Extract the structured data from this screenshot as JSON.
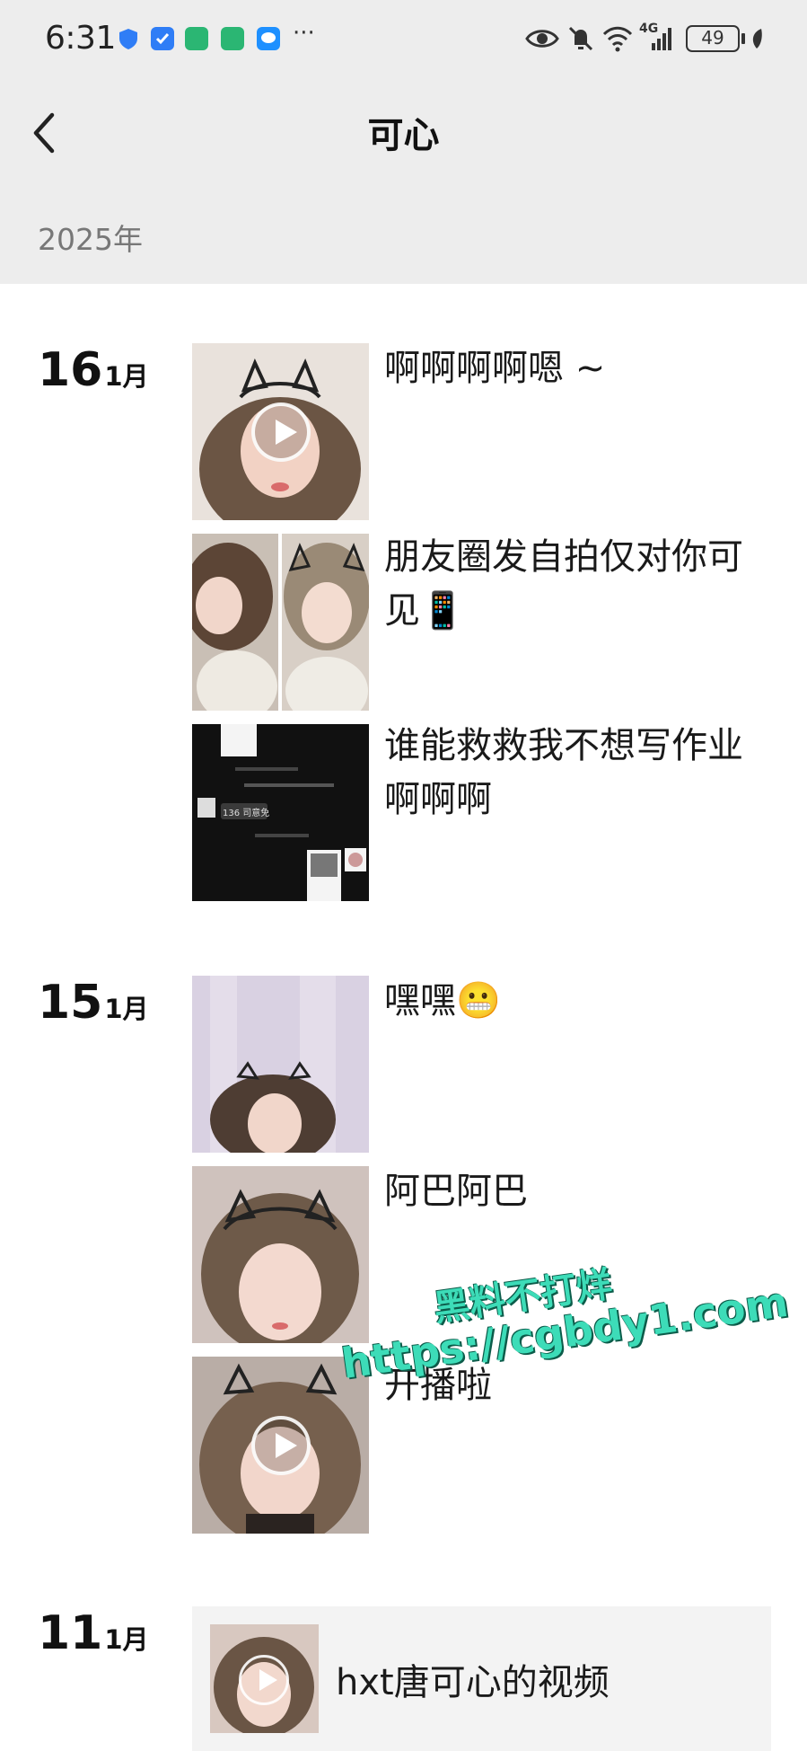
{
  "status_bar": {
    "time": "6:31",
    "dots": "···",
    "network": "4G",
    "battery": "49"
  },
  "nav": {
    "back_icon": "chevron-left-icon",
    "title": "可心"
  },
  "year": "2025年",
  "days": [
    {
      "day": "16",
      "month": "1月",
      "posts": [
        {
          "caption": "啊啊啊啊嗯 ~",
          "type": "video"
        },
        {
          "caption": "朋友圈发自拍仅对你可见📱",
          "type": "image"
        },
        {
          "caption": "谁能救救我不想写作业啊啊啊",
          "type": "screenshot",
          "screenshot_texts": [
            "136 司意免"
          ]
        }
      ]
    },
    {
      "day": "15",
      "month": "1月",
      "posts": [
        {
          "caption": "嘿嘿😬",
          "type": "image"
        },
        {
          "caption": "阿巴阿巴",
          "type": "image"
        },
        {
          "caption": "开播啦",
          "type": "video"
        }
      ]
    },
    {
      "day": "11",
      "month": "1月",
      "share": {
        "title": "hxt唐可心的视频",
        "type": "video"
      }
    }
  ],
  "watermark": {
    "line1": "黑料不打烊",
    "line2": "https://cgbdy1.com"
  },
  "colors": {
    "top_band": "#ededed",
    "watermark": "#3ddcb8"
  }
}
